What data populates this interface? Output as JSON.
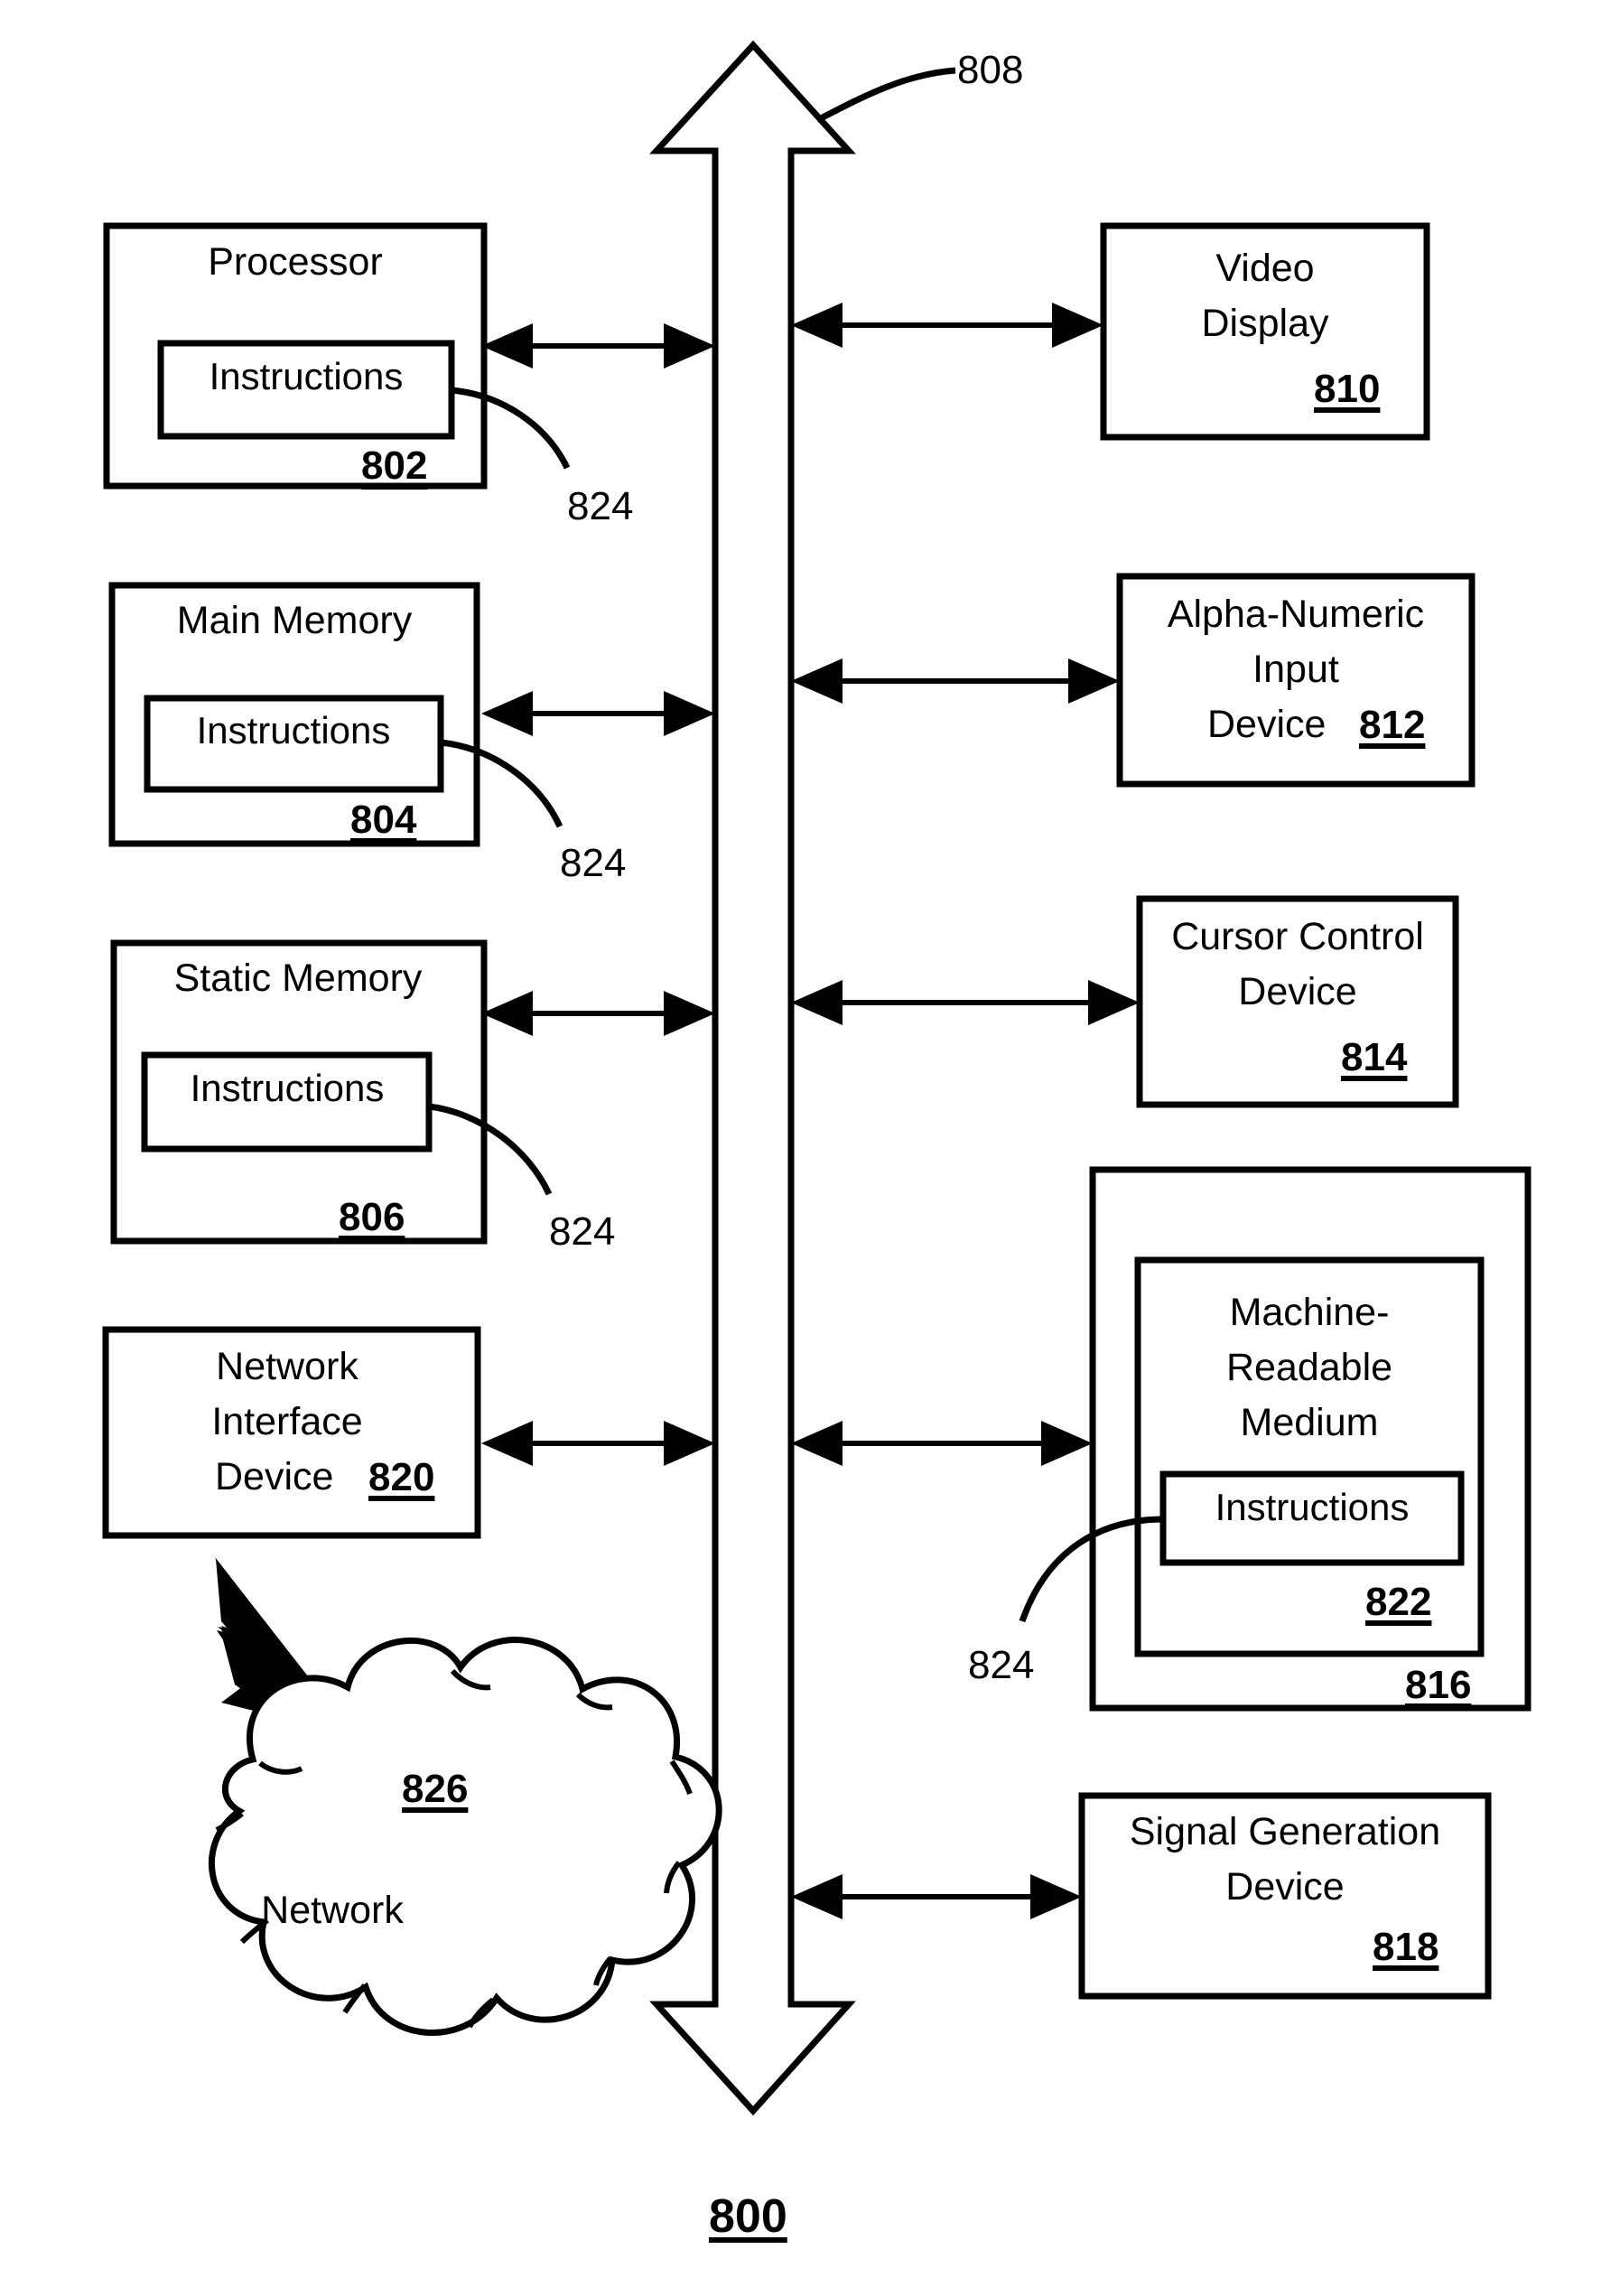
{
  "figure": {
    "figure_number": "800",
    "bus": {
      "label": "808",
      "name": "system-bus"
    },
    "left_column": [
      {
        "id": "processor",
        "title": "Processor",
        "ref": "802",
        "inner_box_label": "Instructions",
        "leader_label": "824"
      },
      {
        "id": "main-memory",
        "title": "Main Memory",
        "ref": "804",
        "inner_box_label": "Instructions",
        "leader_label": "824"
      },
      {
        "id": "static-memory",
        "title": "Static Memory",
        "ref": "806",
        "inner_box_label": "Instructions",
        "leader_label": "824"
      },
      {
        "id": "network-interface-device",
        "title_line1": "Network",
        "title_line2": "Interface",
        "title_line3": "Device",
        "ref": "820",
        "ref_inline": true
      }
    ],
    "right_column": [
      {
        "id": "video-display",
        "title_line1": "Video",
        "title_line2": "Display",
        "ref": "810",
        "ref_inline": false
      },
      {
        "id": "alpha-numeric-input-device",
        "title_line1": "Alpha-Numeric",
        "title_line2": "Input",
        "title_line3": "Device",
        "ref": "812",
        "ref_inline": true
      },
      {
        "id": "cursor-control-device",
        "title_line1": "Cursor Control",
        "title_line2": "Device",
        "ref": "814",
        "ref_inline": false
      },
      {
        "id": "machine-readable-medium",
        "outer_ref": "816",
        "inner_ref": "822",
        "title_line1": "Machine-",
        "title_line2": "Readable",
        "title_line3": "Medium",
        "inner_box_label": "Instructions",
        "leader_label": "824"
      },
      {
        "id": "signal-generation-device",
        "title_line1": "Signal Generation",
        "title_line2": "Device",
        "ref": "818",
        "ref_inline": false
      }
    ],
    "network_cloud": {
      "id": "network-cloud",
      "label": "Network",
      "ref": "826"
    },
    "colors": {
      "stroke": "#000000",
      "background": "#ffffff"
    }
  }
}
